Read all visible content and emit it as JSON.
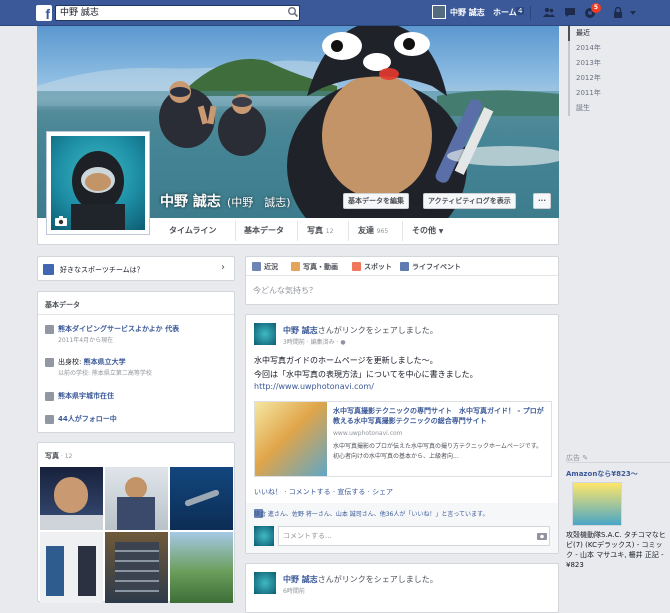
{
  "topbar": {
    "search_value": "中野 誠志",
    "user_name": "中野 誠志",
    "home_label": "ホーム",
    "home_count": "4",
    "notification_count": "5"
  },
  "profile": {
    "name": "中野 誠志",
    "name_paren": "(中野　誠志)",
    "edit_button": "基本データを編集",
    "activity_button": "アクティビティログを表示",
    "more_button": "···"
  },
  "tabs": [
    {
      "label": "タイムライン"
    },
    {
      "label": "基本データ"
    },
    {
      "label": "写真",
      "count": "12"
    },
    {
      "label": "友達",
      "count": "965"
    },
    {
      "label": "その他"
    }
  ],
  "years": [
    "最近",
    "2014年",
    "2013年",
    "2012年",
    "2011年",
    "誕生"
  ],
  "sports": {
    "label": "好きなスポーツチームは？"
  },
  "about": {
    "title": "基本データ",
    "work": "熊本ダイビングサービスよかよか 代表",
    "work_sub": "2011年4月から現在",
    "edu": "出身校: ",
    "edu_link": "熊本県立大学",
    "edu_sub": "以前の学校: 熊本県立第二高等学校",
    "home": "熊本県宇城市在住",
    "followers": "44人がフォロー中"
  },
  "photos": {
    "title": "写真",
    "count": "12"
  },
  "composer": {
    "tabs": [
      "近況",
      "写真・動画",
      "スポット",
      "ライフイベント"
    ],
    "placeholder": "今どんな気持ち？"
  },
  "post1": {
    "name": "中野 誠志",
    "action": "さんがリンクをシェアしました。",
    "time": "3時間前",
    "edited": "編集済み",
    "text1": "水中写真ガイドのホームページを更新しました〜。",
    "text2": "今回は「水中写真の表現方法」についてを中心に書きました。",
    "url": "http://www.uwphotonavi.com/",
    "link_title": "水中写真撮影テクニックの専門サイト　水中写真ガイド！ - プロが教える水中写真撮影テクニックの総合専門サイト",
    "link_domain": "www.uwphotonavi.com",
    "link_desc": "水中写真撮影のプロが伝えた水中写真の撮り方テクニックホームページです。初心者向けの水中写真の基本から、上級者向...",
    "like": "いいね！",
    "comment": "コメントする",
    "promote": "宣伝する",
    "share": "シェア",
    "likes_text": "鎌倉 進さん、佐野 将一さん、山本 誠司さん、他36人が「いいね！」と言っています。",
    "comment_ph": "コメントする..."
  },
  "post2": {
    "name": "中野 誠志",
    "action": "さんがリンクをシェアしました。",
    "time": "6時間前"
  },
  "ads": {
    "title": "広告",
    "amazon": "Amazonなら¥823〜",
    "book_text": "攻殻機動隊S.A.C. タチコマなヒビ(7) (KCデラックス) - コミック - 山本 マサユキ, 柵井 正記 - ¥823"
  }
}
